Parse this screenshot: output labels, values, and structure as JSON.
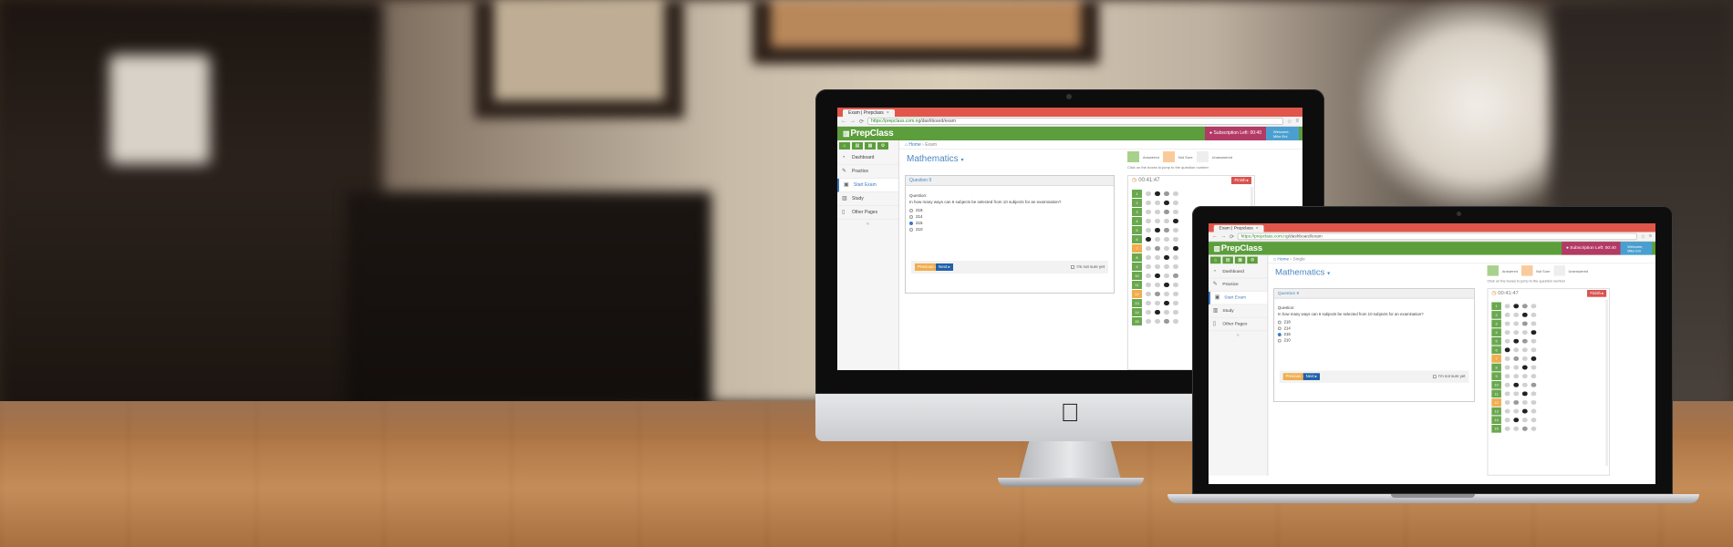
{
  "app": {
    "tab_title": "Exam | Prepclass",
    "url_scheme": "https://",
    "url_host": "prepclass.com.ng",
    "url_path": "/dashboard/exam",
    "brand": "PrepClass",
    "subscription": "Subscription Left: 00:40",
    "welcome": "Welcome, Mike Eni",
    "sidebar": {
      "quick_icons": [
        "home-icon",
        "book-icon",
        "chart-icon",
        "gear-icon"
      ],
      "items": [
        {
          "label": "Dashboard",
          "icon": "dashboard-icon"
        },
        {
          "label": "Practice",
          "icon": "pencil-icon"
        },
        {
          "label": "Start Exam",
          "icon": "clipboard-icon",
          "active": true
        },
        {
          "label": "Study",
          "icon": "book-icon"
        },
        {
          "label": "Other Pages",
          "icon": "file-icon"
        }
      ]
    },
    "breadcrumb": {
      "home": "Home",
      "current_imac": "Exam",
      "current_macbook": "Single"
    },
    "subject": "Mathematics",
    "legend": {
      "answered": "Answered",
      "not_sure": "Not Sure",
      "unanswered": "Unanswered",
      "hint": "Click on the boxes to jump to the question number",
      "colors": {
        "answered": "#a9d18e",
        "not_sure": "#f9cb9c",
        "unanswered": "#eeeeee"
      }
    },
    "question": {
      "header": "Question 9",
      "label": "Question:",
      "text": "In how many ways can 6 subjects be selected from 10 subjects for an examination?",
      "options": [
        "218",
        "214",
        "215",
        "210"
      ],
      "selected_index": 2,
      "prev_label": "Previous",
      "next_label": "Next",
      "not_sure_label": "I'm not sure yet"
    },
    "timer": {
      "value": "00:41:47",
      "finish_label": "Finish"
    },
    "question_numbers": [
      "1",
      "2",
      "3",
      "4",
      "5",
      "6",
      "7",
      "8",
      "9",
      "10",
      "11",
      "12",
      "13",
      "14",
      "15"
    ],
    "orange_numbers": [
      7,
      12
    ]
  }
}
